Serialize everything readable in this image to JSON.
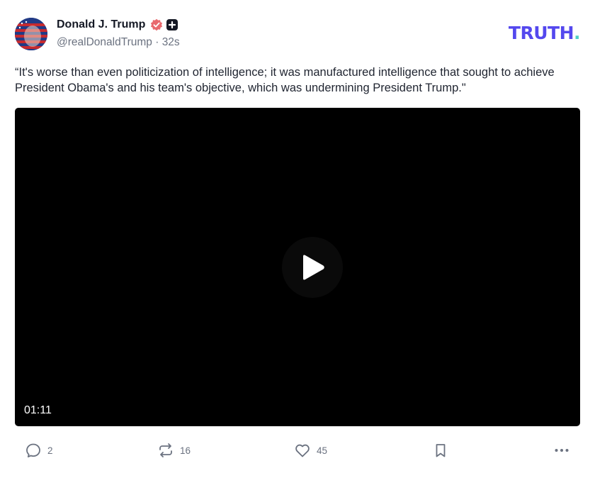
{
  "post": {
    "author": {
      "display_name": "Donald J. Trump",
      "handle": "@realDonaldTrump",
      "time_ago": "32s"
    },
    "brand": {
      "logo_text": "TRUTH",
      "logo_dot": "."
    },
    "text": "“It's worse than even politicization of intelligence; it was manufactured intelligence that sought to achieve President Obama's and his team's objective, which was undermining President Trump.\"",
    "video": {
      "duration": "01:11"
    },
    "actions": {
      "replies": "2",
      "retruths": "16",
      "likes": "45"
    }
  },
  "colors": {
    "brand": "#5448ee",
    "brand_dot": "#4fd1c5",
    "verified": "#e8696e",
    "muted": "#6b7280"
  },
  "icons": [
    "verified-badge-icon",
    "plus-badge-icon",
    "play-icon",
    "reply-icon",
    "retruth-icon",
    "heart-icon",
    "bookmark-icon",
    "more-icon"
  ]
}
